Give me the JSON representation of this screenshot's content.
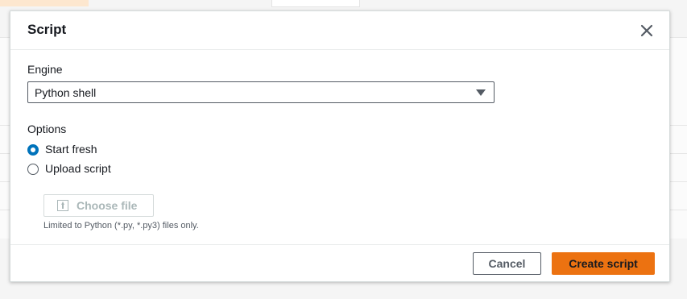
{
  "modal": {
    "title": "Script"
  },
  "engine": {
    "label": "Engine",
    "selected": "Python shell"
  },
  "options": {
    "label": "Options",
    "items": [
      {
        "label": "Start fresh",
        "checked": true
      },
      {
        "label": "Upload script",
        "checked": false
      }
    ]
  },
  "upload": {
    "button_label": "Choose file",
    "hint": "Limited to Python (*.py, *.py3) files only."
  },
  "footer": {
    "cancel_label": "Cancel",
    "create_label": "Create script"
  },
  "colors": {
    "primary": "#ec7211",
    "radio_selected": "#0073bb"
  },
  "icons": {
    "close": "close-icon",
    "caret": "caret-down-icon",
    "upload": "upload-icon"
  }
}
